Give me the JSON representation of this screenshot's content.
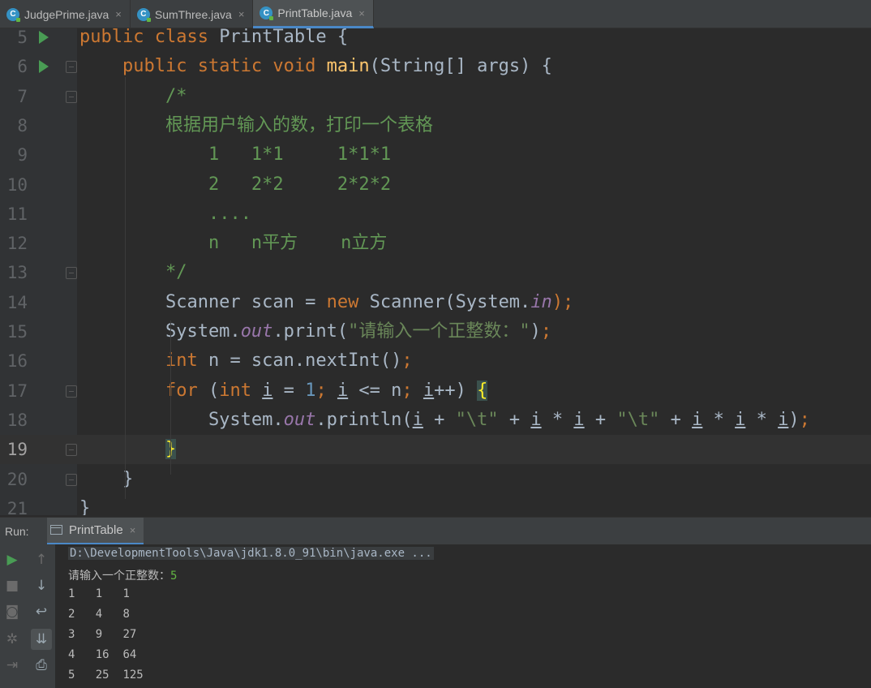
{
  "tabs": [
    {
      "label": "JudgePrime.java",
      "active": false
    },
    {
      "label": "SumThree.java",
      "active": false
    },
    {
      "label": "PrintTable.java",
      "active": true
    }
  ],
  "tab_close_glyph": "×",
  "editor": {
    "lines": [
      {
        "num": "5",
        "run": true,
        "fold": false,
        "tokens": [
          [
            "kw",
            "public class "
          ],
          [
            "",
            "PrintTable {"
          ]
        ]
      },
      {
        "num": "6",
        "run": true,
        "fold": true,
        "tokens": [
          [
            "",
            "    "
          ],
          [
            "kw",
            "public static void "
          ],
          [
            "fn",
            "main"
          ],
          [
            "",
            "(String[] args) {"
          ]
        ]
      },
      {
        "num": "7",
        "run": false,
        "fold": true,
        "tokens": [
          [
            "",
            "        "
          ],
          [
            "cm",
            "/*"
          ]
        ]
      },
      {
        "num": "8",
        "run": false,
        "fold": false,
        "tokens": [
          [
            "",
            "        "
          ],
          [
            "cm",
            "根据用户输入的数，打印一个表格"
          ]
        ]
      },
      {
        "num": "9",
        "run": false,
        "fold": false,
        "tokens": [
          [
            "",
            "            "
          ],
          [
            "cm",
            "1   1*1     1*1*1"
          ]
        ]
      },
      {
        "num": "10",
        "run": false,
        "fold": false,
        "tokens": [
          [
            "",
            "            "
          ],
          [
            "cm",
            "2   2*2     2*2*2"
          ]
        ]
      },
      {
        "num": "11",
        "run": false,
        "fold": false,
        "tokens": [
          [
            "",
            "            "
          ],
          [
            "cm",
            "...."
          ]
        ]
      },
      {
        "num": "12",
        "run": false,
        "fold": false,
        "tokens": [
          [
            "",
            "            "
          ],
          [
            "cm",
            "n   n平方    n立方"
          ]
        ]
      },
      {
        "num": "13",
        "run": false,
        "fold": true,
        "tokens": [
          [
            "",
            "        "
          ],
          [
            "cm",
            "*/"
          ]
        ]
      },
      {
        "num": "14",
        "run": false,
        "fold": false,
        "tokens": [
          [
            "",
            "        Scanner scan = "
          ],
          [
            "kw",
            "new "
          ],
          [
            "",
            "Scanner(System."
          ],
          [
            "st",
            "in"
          ],
          [
            "kw",
            ");"
          ]
        ]
      },
      {
        "num": "15",
        "run": false,
        "fold": false,
        "tokens": [
          [
            "",
            "        System."
          ],
          [
            "st",
            "out"
          ],
          [
            "",
            ".print("
          ],
          [
            "str",
            "\"请输入一个正整数：\""
          ],
          [
            "",
            ")"
          ],
          [
            "kw",
            ";"
          ]
        ]
      },
      {
        "num": "16",
        "run": false,
        "fold": false,
        "tokens": [
          [
            "",
            "        "
          ],
          [
            "kw",
            "int "
          ],
          [
            "",
            "n = scan.nextInt()"
          ],
          [
            "kw",
            ";"
          ]
        ]
      },
      {
        "num": "17",
        "run": false,
        "fold": true,
        "tokens": [
          [
            "",
            "        "
          ],
          [
            "kw",
            "for "
          ],
          [
            "",
            "("
          ],
          [
            "kw",
            "int "
          ],
          [
            "u",
            "i"
          ],
          [
            "",
            " = "
          ],
          [
            "num",
            "1"
          ],
          [
            "kw",
            "; "
          ],
          [
            "u",
            "i"
          ],
          [
            "",
            " <= n"
          ],
          [
            "kw",
            "; "
          ],
          [
            "u",
            "i"
          ],
          [
            "",
            "++) "
          ],
          [
            "hb",
            "{"
          ]
        ]
      },
      {
        "num": "18",
        "run": false,
        "fold": false,
        "tokens": [
          [
            "",
            "            System."
          ],
          [
            "st",
            "out"
          ],
          [
            "",
            ".println("
          ],
          [
            "u",
            "i"
          ],
          [
            "",
            " + "
          ],
          [
            "str",
            "\"\\t\""
          ],
          [
            "",
            " + "
          ],
          [
            "u",
            "i"
          ],
          [
            "",
            " * "
          ],
          [
            "u",
            "i"
          ],
          [
            "",
            " + "
          ],
          [
            "str",
            "\"\\t\""
          ],
          [
            "",
            " + "
          ],
          [
            "u",
            "i"
          ],
          [
            "",
            " * "
          ],
          [
            "u",
            "i"
          ],
          [
            "",
            " * "
          ],
          [
            "u",
            "i"
          ],
          [
            "",
            ")"
          ],
          [
            "kw",
            ";"
          ]
        ]
      },
      {
        "num": "19",
        "run": false,
        "fold": true,
        "current": true,
        "tokens": [
          [
            "",
            "        "
          ],
          [
            "hb",
            "}"
          ]
        ]
      },
      {
        "num": "20",
        "run": false,
        "fold": true,
        "tokens": [
          [
            "",
            "    }"
          ]
        ]
      },
      {
        "num": "21",
        "run": false,
        "fold": false,
        "tokens": [
          [
            "",
            "}"
          ]
        ]
      }
    ]
  },
  "run_panel": {
    "label": "Run:",
    "tab_label": "PrintTable",
    "command": "D:\\DevelopmentTools\\Java\\jdk1.8.0_91\\bin\\java.exe ...",
    "prompt": "请输入一个正整数：",
    "input": "5",
    "output": [
      "1\t1\t1",
      "2\t4\t8",
      "3\t9\t27",
      "4\t16\t64",
      "5\t25\t125"
    ]
  },
  "colors": {
    "keyword": "#cc7832",
    "method": "#ffc66d",
    "comment": "#629755",
    "string": "#6a8759",
    "number": "#6897bb",
    "static_field": "#9876aa",
    "run_icon": "#499c54"
  }
}
